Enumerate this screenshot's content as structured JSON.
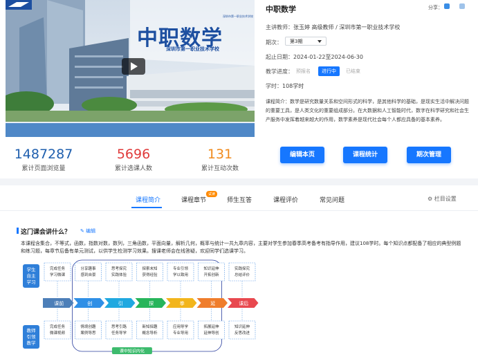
{
  "cover": {
    "title": "中职数学",
    "school": "深圳市第一职业技术学校",
    "logo_text": "深圳市第一职业技术学校"
  },
  "stats": [
    {
      "value": "1487287",
      "label": "累计页面浏览量",
      "color": "#1f5fae"
    },
    {
      "value": "5696",
      "label": "累计选课人数",
      "color": "#e03b3b"
    },
    {
      "value": "131",
      "label": "累计互动次数",
      "color": "#f08a1c"
    }
  ],
  "course": {
    "title": "中职数学",
    "share_label": "分享：",
    "teacher_key": "主讲教师：",
    "teacher_value": "张玉婷  高级教师 / 深圳市第一职业技术学校",
    "term_key": "期次：",
    "term_value": "第3期",
    "date_key": "起止日期：",
    "date_value": "2024-01-22至2024-06-30",
    "progress_key": "教学进度：",
    "progress": [
      "预报名",
      "进行中",
      "已结束"
    ],
    "hours_key": "学时：",
    "hours_value": "108学时",
    "desc_key": "课程简介：",
    "desc_value": "数学是研究数量关系和空间形式的科学，是其他科学的基础，是现实生活中解决问题的重要工具，是人类文化的重要组成部分。在大数据和人工智能时代，数字在科学研究和社会生产服务中发挥着越来越大的作用，数学素养是现代社会每个人都应具备的基本素养。"
  },
  "buttons": [
    "编辑本页",
    "课程统计",
    "期次管理"
  ],
  "tabs": [
    "课程简介",
    "课程章节",
    "师生互答",
    "课程评价",
    "常见问题"
  ],
  "trial_badge": "试读",
  "column_settings": "栏目设置",
  "section": {
    "title": "这门课会讲什么？",
    "edit": "编辑",
    "intro": "本课程含集合，不等式，函数，指数对数，数列，三角函数，平面向量，解析几何，概率与统计一共九章内容，主要对学生参加春季高考备考有指导作用，建议108学时。每个知识点都配备了相应的典型例题和练习题，每章节后备有单元测试，以供学生检测学习效果。搜课老师会在线答疑，欢迎同学们选课学习。"
  },
  "diagram": {
    "student_label": [
      "学生",
      "自主",
      "学习"
    ],
    "teacher_label": [
      "教师",
      "引领",
      "教学"
    ],
    "top_boxes": [
      [
        "完成任务",
        "学习微课"
      ],
      [
        "分享趣事",
        "感到自豪"
      ],
      [
        "思考探究",
        "实践体验"
      ],
      [
        "探索未知",
        "获得经验"
      ],
      [
        "专业引领",
        "学以致用"
      ],
      [
        "知识延伸",
        "开拓创新"
      ],
      [
        "实践探究",
        "总结评价"
      ]
    ],
    "bottom_boxes": [
      [
        "完成任务",
        "微课视频"
      ],
      [
        "情境创趣",
        "案例导思"
      ],
      [
        "思考引路",
        "任务导学"
      ],
      [
        "新知探趣",
        "概念导析"
      ],
      [
        "应用导学",
        "专业导用"
      ],
      [
        "拓展延伸",
        "延伸导创"
      ],
      [
        "知识延伸",
        "反思改进"
      ]
    ],
    "stages": [
      {
        "label": "课前",
        "color": "#4d7fb8"
      },
      {
        "label": "创",
        "color": "#2f8fe6"
      },
      {
        "label": "引",
        "color": "#20a8e0"
      },
      {
        "label": "探",
        "color": "#27b55b"
      },
      {
        "label": "拳",
        "color": "#f2b51c"
      },
      {
        "label": "延",
        "color": "#ef7d2c"
      },
      {
        "label": "课后",
        "color": "#e8484f"
      }
    ],
    "core_label": "课中知识内化"
  }
}
